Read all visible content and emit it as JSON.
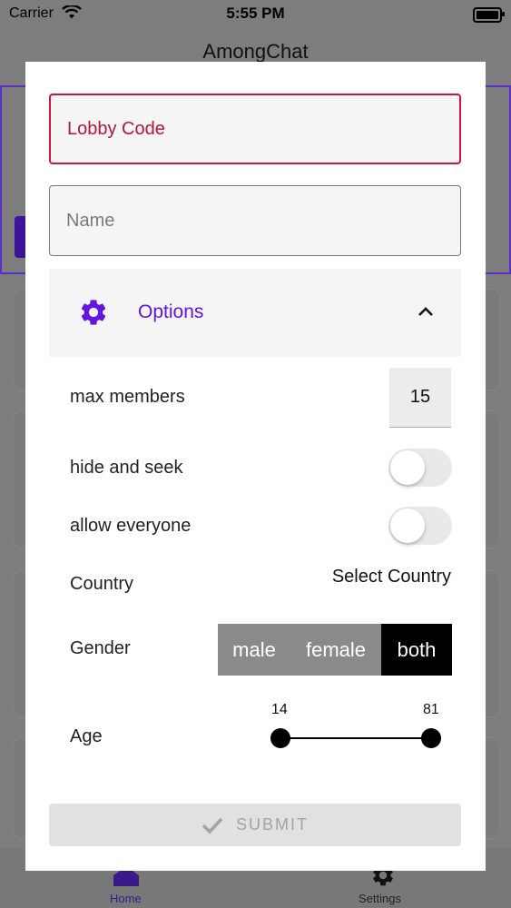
{
  "status_bar": {
    "carrier": "Carrier",
    "time": "5:55 PM"
  },
  "app": {
    "title": "AmongChat"
  },
  "tabs": {
    "home": "Home",
    "settings": "Settings"
  },
  "form": {
    "lobby_code_placeholder": "Lobby Code",
    "name_placeholder": "Name",
    "options_label": "Options",
    "max_members_label": "max members",
    "max_members_value": "15",
    "hide_and_seek_label": "hide and seek",
    "hide_and_seek_on": false,
    "allow_everyone_label": "allow everyone",
    "allow_everyone_on": false,
    "country_label": "Country",
    "select_country": "Select Country",
    "gender_label": "Gender",
    "gender_options": [
      "male",
      "female",
      "both"
    ],
    "gender_selected": "both",
    "age_label": "Age",
    "age_min": "14",
    "age_max": "81",
    "submit_label": "SUBMIT"
  },
  "colors": {
    "accent": "#6216e0",
    "error": "#c8193c",
    "segment_selected": "#000000",
    "segment_default": "#8a8a8a"
  }
}
